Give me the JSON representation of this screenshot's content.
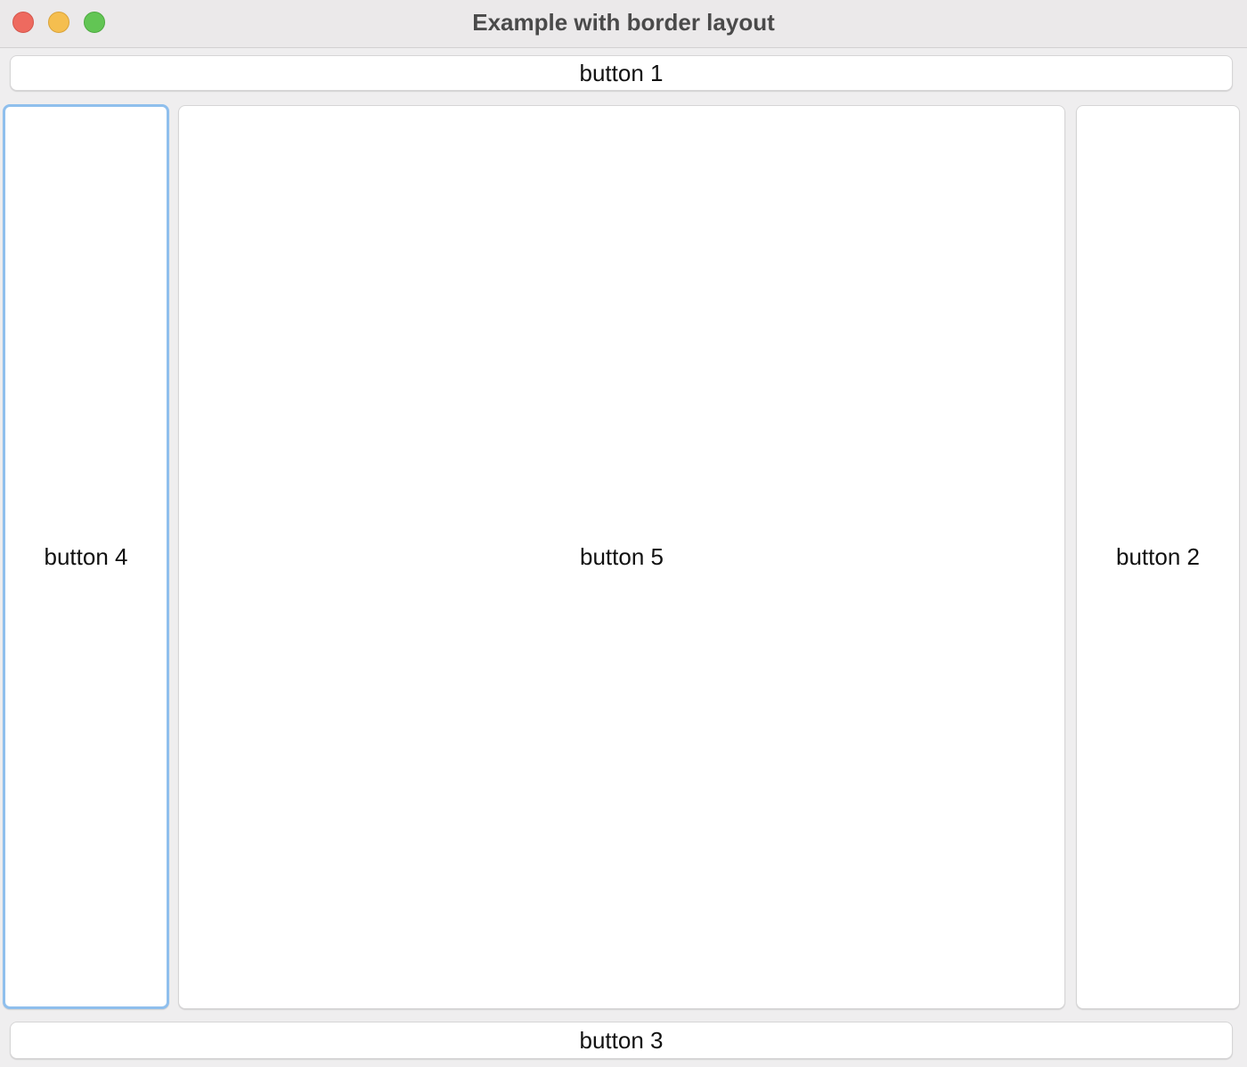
{
  "window": {
    "title": "Example with border layout"
  },
  "buttons": {
    "north": "button 1",
    "west": "button 4",
    "center": "button 5",
    "east": "button 2",
    "south": "button 3"
  },
  "colors": {
    "focus_ring": "#8fbfed",
    "close": "#ee6a5f",
    "minimize": "#f5be4f",
    "zoom": "#62c554"
  }
}
